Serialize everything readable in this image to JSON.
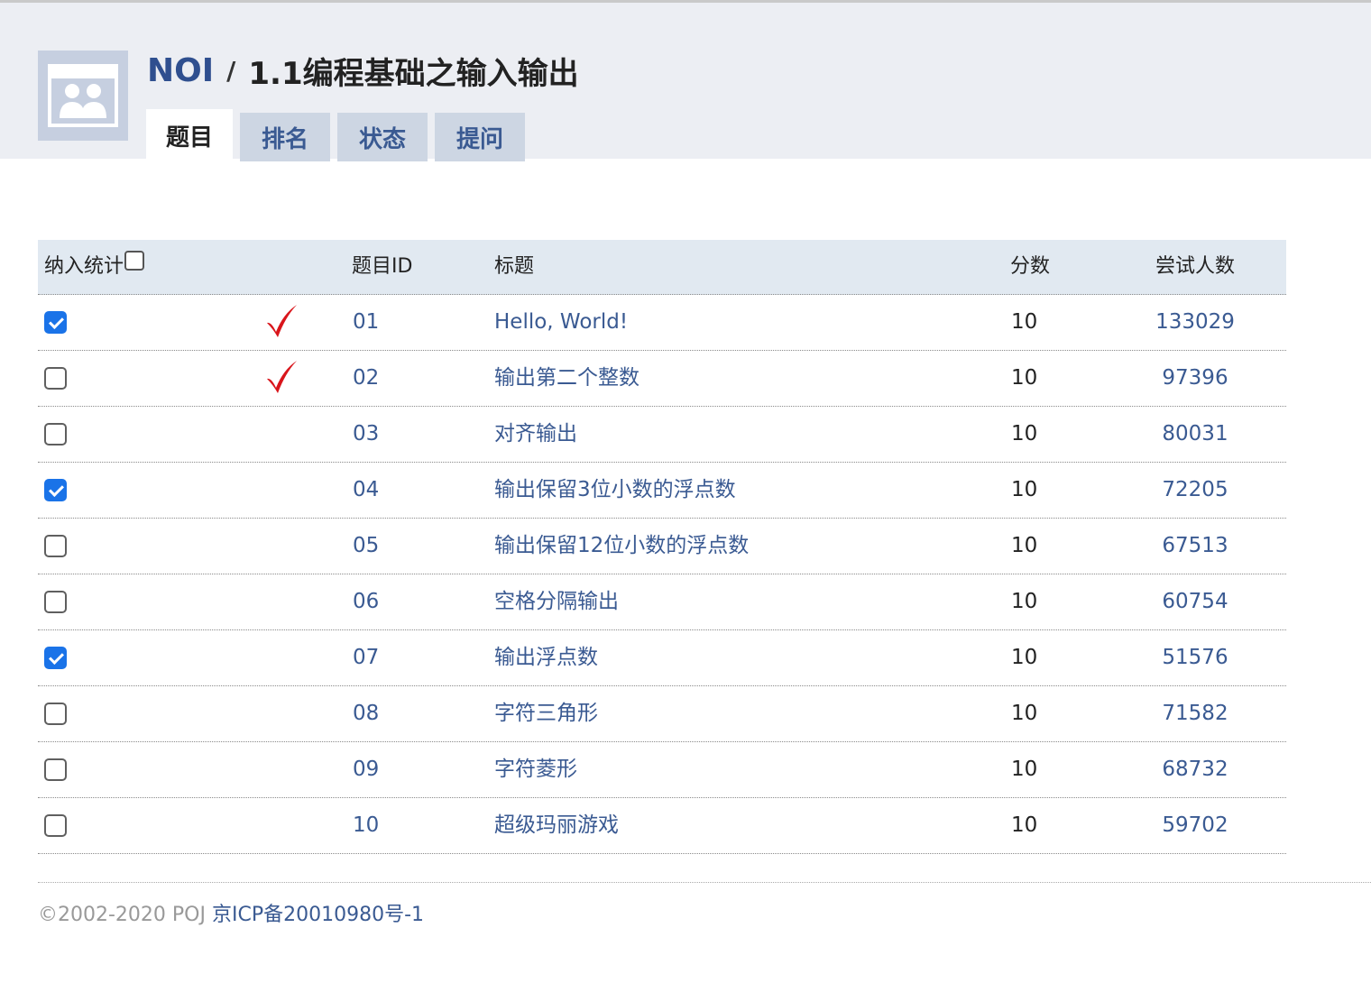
{
  "header": {
    "org": "NOI",
    "separator": "/",
    "group_name": "1.1编程基础之输入输出",
    "avatar_icon": "group-users-icon"
  },
  "tabs": [
    {
      "label": "题目",
      "active": true
    },
    {
      "label": "排名",
      "active": false
    },
    {
      "label": "状态",
      "active": false
    },
    {
      "label": "提问",
      "active": false
    }
  ],
  "table": {
    "headers": {
      "include": "纳入统计",
      "id": "题目ID",
      "title": "标题",
      "score": "分数",
      "tries": "尝试人数"
    },
    "header_checkbox_checked": false,
    "rows": [
      {
        "checked": true,
        "solved": true,
        "id": "01",
        "title": "Hello, World!",
        "score": "10",
        "tries": "133029"
      },
      {
        "checked": false,
        "solved": true,
        "id": "02",
        "title": "输出第二个整数",
        "score": "10",
        "tries": "97396"
      },
      {
        "checked": false,
        "solved": false,
        "id": "03",
        "title": "对齐输出",
        "score": "10",
        "tries": "80031"
      },
      {
        "checked": true,
        "solved": false,
        "id": "04",
        "title": "输出保留3位小数的浮点数",
        "score": "10",
        "tries": "72205"
      },
      {
        "checked": false,
        "solved": false,
        "id": "05",
        "title": "输出保留12位小数的浮点数",
        "score": "10",
        "tries": "67513"
      },
      {
        "checked": false,
        "solved": false,
        "id": "06",
        "title": "空格分隔输出",
        "score": "10",
        "tries": "60754"
      },
      {
        "checked": true,
        "solved": false,
        "id": "07",
        "title": "输出浮点数",
        "score": "10",
        "tries": "51576"
      },
      {
        "checked": false,
        "solved": false,
        "id": "08",
        "title": "字符三角形",
        "score": "10",
        "tries": "71582"
      },
      {
        "checked": false,
        "solved": false,
        "id": "09",
        "title": "字符菱形",
        "score": "10",
        "tries": "68732"
      },
      {
        "checked": false,
        "solved": false,
        "id": "10",
        "title": "超级玛丽游戏",
        "score": "10",
        "tries": "59702"
      }
    ]
  },
  "footer": {
    "copyright": "©2002-2020 POJ",
    "icp": "京ICP备20010980号-1"
  },
  "colors": {
    "link": "#3a5a92",
    "header_bg": "#eceef3",
    "table_header_bg": "#e1e9f1",
    "tab_bg": "#cdd6e3",
    "checkbox_checked": "#1a73e8",
    "solved_tick": "#d9151b"
  }
}
